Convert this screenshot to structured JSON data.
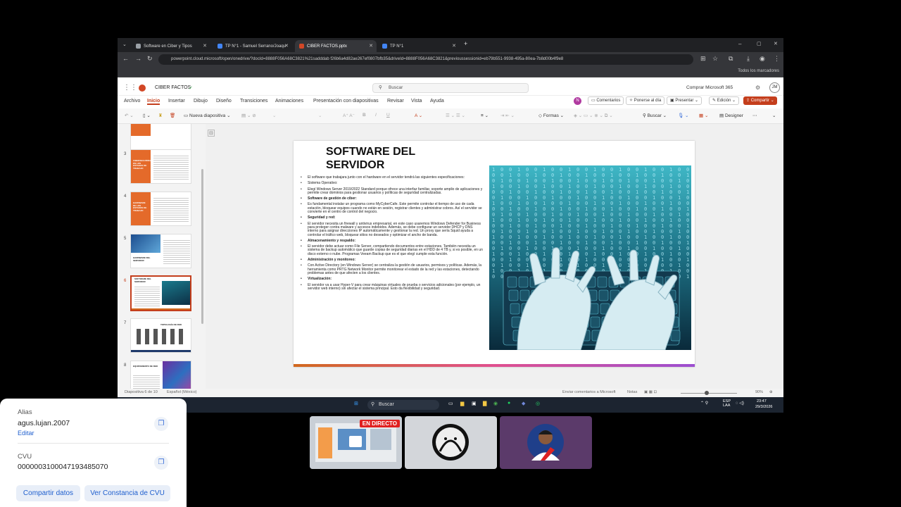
{
  "browser": {
    "tabs": [
      {
        "label": "Software en Ciber y Tipos",
        "color": "#9aa0a6"
      },
      {
        "label": "TP N°1 - Samuel Serrano/Joaqu",
        "color": "#4285f4"
      },
      {
        "label": "CIBER FACTOS.pptx",
        "color": "#d24726"
      },
      {
        "label": "TP N°1",
        "color": "#4285f4"
      }
    ],
    "new_tab": "+",
    "url": "powerpoint.cloud.microsoft/open/onedrive/?docId=8888F056A68C3821%21sadddab f26b6a4d82ae267ef0807bfb35&driveId=8888F056A68C3821&previoussessionid=eb79b551-9938-495a-80ea-7b8d00b4f9e8",
    "bookmarks": "Todos los marcadores"
  },
  "ppt": {
    "doc_name": "CIBER FACTOS",
    "search_placeholder": "Buscar",
    "buy_label": "Comprar Microsoft 365",
    "avatar": "JM",
    "ribbon_tabs": [
      "Archivo",
      "Inicio",
      "Insertar",
      "Dibujo",
      "Diseño",
      "Transiciones",
      "Animaciones",
      "Presentación con diapositivas",
      "Revisar",
      "Vista",
      "Ayuda"
    ],
    "ribbon_right": {
      "comments": "Comentarios",
      "catchup": "Ponerse al día",
      "present": "Presentar",
      "edit": "Edición",
      "share": "Compartir"
    },
    "toolbar": {
      "new_slide": "Nueva diapositiva",
      "shapes": "Formas",
      "find": "Buscar",
      "designer": "Designer"
    },
    "thumbnails": [
      {
        "num": "3",
        "caption": "CIBERSEGURIDAD EN LOS ESTADOS DE TRABAJO"
      },
      {
        "num": "4",
        "caption": "HARDWARE DE LOS ESTADOS DE TRABAJO"
      },
      {
        "num": "5",
        "caption": "HARDWARE DEL SERVIDOR"
      },
      {
        "num": "6",
        "caption": "SOFTWARE DEL SERVIDOR"
      },
      {
        "num": "7",
        "caption": "TOPOLOGÍA DE RED"
      },
      {
        "num": "8",
        "caption": "EQUIPAMIENTO DE RED"
      }
    ],
    "slide": {
      "title": "SOFTWARE DEL SERVIDOR",
      "bullets": [
        {
          "text": "El software que trabajara junto con el hardware en el servidor tendrá las siguientes especificaciones:",
          "head": false
        },
        {
          "text": "Sistema Operativo:",
          "head": false
        },
        {
          "text": "Elegí Windows Server 2019/2022 Standard porque ofrece una interfaz familiar, soporte amplio de aplicaciones y permite crear dominios para gestionar usuarios y políticas de seguridad centralizadas.",
          "head": false
        },
        {
          "text": "Software de gestión de ciber:",
          "head": true
        },
        {
          "text": "Es fundamental instalar un programa como MyCyberCafe. Este permite controlar el tiempo de uso de cada estación, bloquear equipos cuando no están en sesión, registrar clientes y administrar cobros. Así el servidor se convierte en el centro de control del negocio.",
          "head": false
        },
        {
          "text": "Seguridad y red:",
          "head": true
        },
        {
          "text": "El servidor necesita un firewall y antivirus empresarial, en este caso usaremos Windows Defender for Business para proteger contra malware y accesos indebidos. Además, se debe configurar un servidor DHCP y DNS interno para asignar direcciones IP automáticamente y gestionar la red. Un proxy que sería Squid ayuda a controlar el tráfico web, bloquear sitios no deseados y optimizar el ancho de banda.",
          "head": false
        },
        {
          "text": "Almacenamiento y respaldo:",
          "head": true
        },
        {
          "text": "El servidor debe actuar como File Server, compartiendo documentos entre estaciones. También necesita un sistema de backup automático que guarde copias de seguridad diarias en el HDD de 4 TB y, si es posible, en un disco externo o nube. Programas Veeam Backup que es el que elegí cumple esta función.",
          "head": false
        },
        {
          "text": "Administración y monitoreo:",
          "head": true
        },
        {
          "text": "Con Active Directory (en Windows Server) se centraliza la gestión de usuarios, permisos y políticas. Además, la herramienta como PRTG Network Monitor permite monitorear el estado de la red y las estaciones, detectando problemas antes de que afecten a los clientes.",
          "head": false
        },
        {
          "text": "Virtualización:",
          "head": true
        },
        {
          "text": "El servidor va a usar Hyper-V para crear máquinas virtuales de prueba o servicios adicionales (por ejemplo, un servidor web interno) sin afectar el sistema principal. Esto da flexibilidad y seguridad.",
          "head": false
        }
      ]
    },
    "status": {
      "slide_count": "Diapositiva 6 de 10",
      "language": "Español (México)",
      "feedback": "Enviar comentarios a Microsoft",
      "notes": "Notas",
      "zoom": "90%"
    }
  },
  "taskbar": {
    "search": "Buscar",
    "lang": "ESP\nLAA",
    "time": "23:47",
    "date": "29/3/2026"
  },
  "bank": {
    "alias_label": "Alias",
    "alias_value": "agus.lujan.2007",
    "edit_label": "Editar",
    "cvu_label": "CVU",
    "cvu_value": "0000003100047193485070",
    "share_button": "Compartir datos",
    "cert_button": "Ver Constancia de CVU"
  },
  "stream": {
    "live_badge": "EN DIRECTO"
  },
  "colors": {
    "accent": "#c43e1c",
    "link": "#1f5fce"
  }
}
